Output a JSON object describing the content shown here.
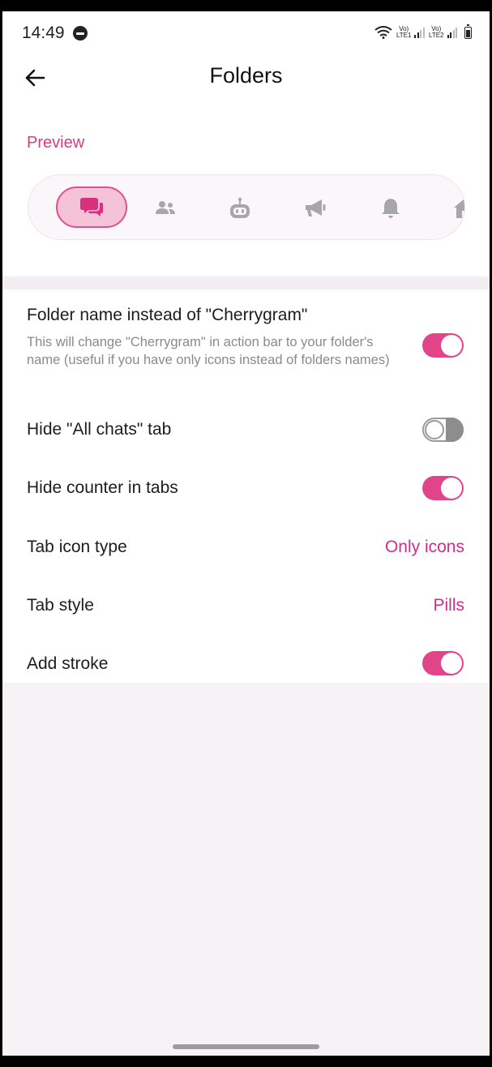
{
  "status_bar": {
    "time": "14:49",
    "sim1_top": "Vo)",
    "sim1_bottom": "LTE1",
    "sim2_top": "Vo)",
    "sim2_bottom": "LTE2"
  },
  "header": {
    "title": "Folders",
    "back_icon": "arrow-left-icon"
  },
  "preview": {
    "label": "Preview",
    "selected_tab": "chats",
    "tabs": [
      {
        "icon": "chat-bubbles-icon",
        "selected": true
      },
      {
        "icon": "users-icon",
        "selected": false
      },
      {
        "icon": "bot-icon",
        "selected": false
      },
      {
        "icon": "megaphone-icon",
        "selected": false
      },
      {
        "icon": "bell-icon",
        "selected": false
      },
      {
        "icon": "home-icon",
        "selected": false
      }
    ]
  },
  "settings": [
    {
      "title": "Folder name instead of \"Cherrygram\"",
      "description": "This will change \"Cherrygram\" in action bar to your folder's name (useful if you have only icons instead of folders names)",
      "toggle": true
    },
    {
      "title": "Hide \"All chats\" tab",
      "toggle": false
    },
    {
      "title": "Hide counter in tabs",
      "toggle": true
    },
    {
      "title": "Tab icon type",
      "value": "Only icons"
    },
    {
      "title": "Tab style",
      "value": "Pills"
    },
    {
      "title": "Add stroke",
      "toggle": true
    }
  ],
  "colors": {
    "accent": "#e2448a",
    "accent_text": "#c9308a",
    "background": "#f7f2f6"
  }
}
